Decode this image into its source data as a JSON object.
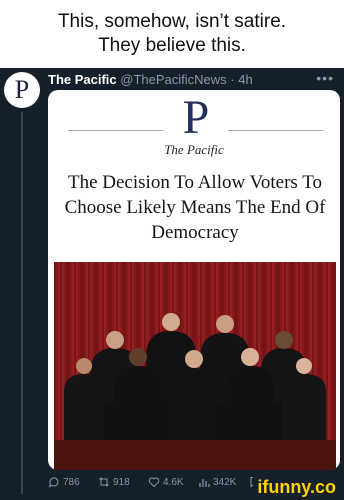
{
  "caption": {
    "line1": "This, somehow, isn’t satire.",
    "line2": "They believe this."
  },
  "tweet": {
    "avatar_letter": "P",
    "author_name": "The Pacific",
    "handle": "@ThePacificNews",
    "separator": " · ",
    "time": "4h",
    "more_icon": "more-horizontal-icon",
    "card": {
      "logo_mark": "P",
      "logo_text": "The Pacific",
      "headline": "The Decision To Allow Voters To Choose Likely Means The End Of Democracy"
    },
    "stats": {
      "replies": "786",
      "retweets": "918",
      "likes": "4.6K",
      "views": "342K"
    }
  },
  "watermark": "ifunny.co",
  "colors": {
    "tweet_bg": "#15202b",
    "muted_text": "#8b98a5",
    "logo_navy": "#23305a",
    "curtain_red": "#8e1d1f",
    "watermark_yellow": "#ffd400"
  }
}
